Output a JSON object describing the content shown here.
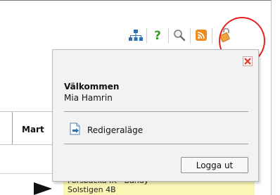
{
  "popup": {
    "welcome_heading": "Välkommen",
    "user_name": "Mia Hamrin",
    "edit_mode_label": "Redigeraläge",
    "logout_label": "Logga ut"
  },
  "toolbar": {
    "icons": [
      "sitemap-icon",
      "help-icon",
      "search-icon",
      "rss-icon",
      "lock-icon"
    ]
  },
  "background": {
    "column_header": "Mart",
    "row_line1": "Forsbacka IK - Bandy",
    "row_line2": "Solstigen 4B"
  },
  "colors": {
    "highlight_circle": "#e32222",
    "close_x": "#e0412e",
    "row_highlight": "#fbf5b6"
  }
}
